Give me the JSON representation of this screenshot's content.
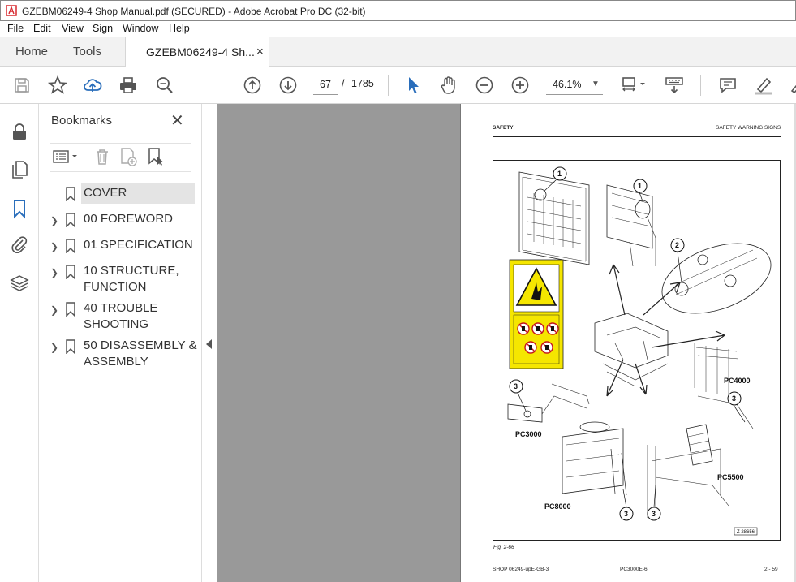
{
  "window": {
    "title": "GZEBM06249-4 Shop Manual.pdf (SECURED) - Adobe Acrobat Pro DC (32-bit)"
  },
  "menu": [
    "File",
    "Edit",
    "View",
    "Sign",
    "Window",
    "Help"
  ],
  "tabs": {
    "home": "Home",
    "tools": "Tools",
    "doc": "GZEBM06249-4 Sh...",
    "doc_close": "×"
  },
  "toolbar": {
    "page_current": "67",
    "page_sep": "/",
    "page_total": "1785",
    "zoom": "46.1%"
  },
  "bookmarks": {
    "header": "Bookmarks",
    "close": "✕",
    "items": [
      {
        "label": "COVER",
        "expandable": false,
        "selected": true
      },
      {
        "label": "00 FOREWORD",
        "expandable": true
      },
      {
        "label": "01 SPECIFICATION",
        "expandable": true
      },
      {
        "label": "10 STRUCTURE, FUNCTION",
        "expandable": true
      },
      {
        "label": "40 TROUBLE SHOOTING",
        "expandable": true
      },
      {
        "label": "50 DISASSEMBLY & ASSEMBLY",
        "expandable": true
      }
    ]
  },
  "document": {
    "header_left": "SAFETY",
    "header_right": "SAFETY WARNING SIGNS",
    "figure_labels": {
      "c1": "1",
      "c2": "1",
      "c3": "2",
      "c4": "3",
      "c5": "3",
      "c6": "3",
      "c7": "3",
      "pc3000": "PC3000",
      "pc4000": "PC4000",
      "pc5500": "PC5500",
      "pc8000": "PC8000",
      "code": "Z 28656"
    },
    "caption": "Fig. 2-66",
    "footer_left": "SHOP 06249-upE-GB-3",
    "footer_center": "PC3000E-6",
    "footer_right": "2 - 59"
  },
  "colors": {
    "warning_yellow": "#f5e600",
    "acrobat_red": "#d7282f",
    "bookmark_blue": "#2a6ebb"
  }
}
